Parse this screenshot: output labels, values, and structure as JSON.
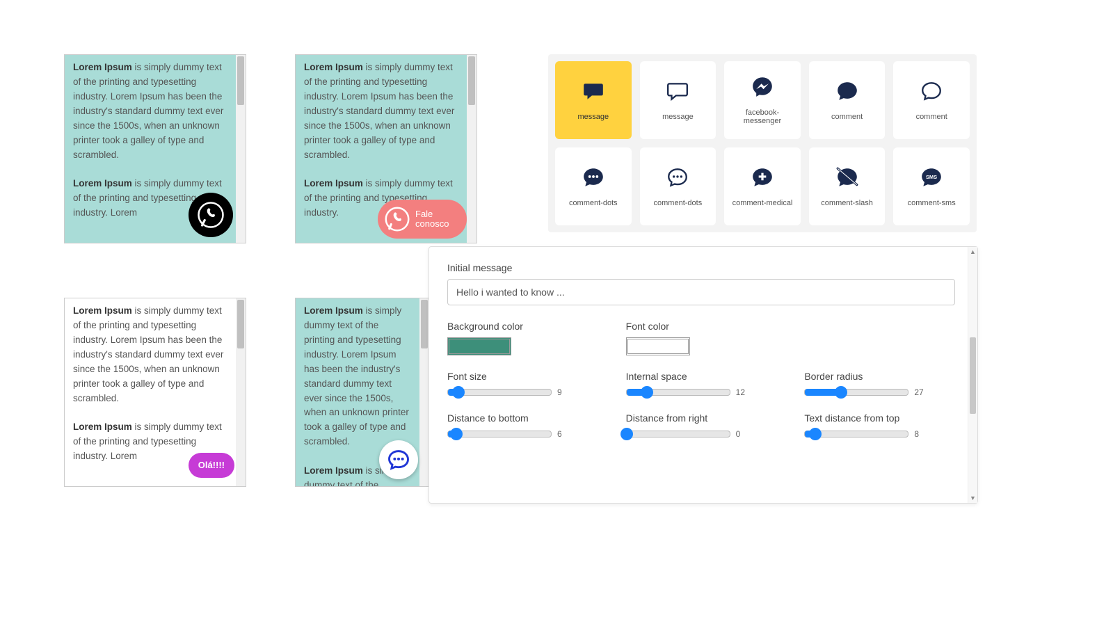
{
  "previews": [
    {
      "teal": true,
      "para1_bold": "Lorem Ipsum",
      "para1": " is simply dummy text of the printing and typesetting industry. Lorem Ipsum has been the industry's standard dummy text ever since the 1500s, when an unknown printer took a galley of type and scrambled.",
      "para2_bold": "Lorem Ipsum",
      "para2": " is simply dummy text of the printing and typesetting industry. Lorem"
    },
    {
      "teal": true,
      "para1_bold": "Lorem Ipsum",
      "para1": " is simply dummy text of the printing and typesetting industry. Lorem Ipsum has been the industry's standard dummy text ever since the 1500s, when an unknown printer took a galley of type and scrambled.",
      "para2_bold": "Lorem Ipsum",
      "para2": " is simply dummy text of the printing and typesetting industry."
    },
    {
      "teal": false,
      "para1_bold": "Lorem Ipsum",
      "para1": " is simply dummy text of the printing and typesetting industry. Lorem Ipsum has been the industry's standard dummy text ever since the 1500s, when an unknown printer took a galley of type and scrambled.",
      "para2_bold": "Lorem Ipsum",
      "para2": " is simply dummy text of the printing and typesetting industry. Lorem"
    },
    {
      "teal": true,
      "para1_bold": "Lorem Ipsum",
      "para1": " is simply dummy text of the printing and typesetting industry. Lorem Ipsum has been the industry's standard dummy text ever since the 1500s, when an unknown printer took a galley of type and scrambled.",
      "para2_bold": "Lorem Ipsum",
      "para2": " is simply dummy text of the printing and typesetting industry."
    }
  ],
  "badges": {
    "b1": {
      "bg": "#000000"
    },
    "b2": {
      "bg": "#f37f7f",
      "text": "Fale conosco"
    },
    "b3": {
      "bg": "#c63bd6",
      "text": "Olá!!!!"
    },
    "b4": {
      "bg": "#ffffff"
    }
  },
  "icons": [
    {
      "name": "message",
      "label": "message",
      "selected": true
    },
    {
      "name": "message-outline",
      "label": "message"
    },
    {
      "name": "facebook-messenger",
      "label": "facebook-messenger"
    },
    {
      "name": "comment-solid",
      "label": "comment"
    },
    {
      "name": "comment-outline",
      "label": "comment"
    },
    {
      "name": "comment-dots-solid",
      "label": "comment-dots"
    },
    {
      "name": "comment-dots-outline",
      "label": "comment-dots"
    },
    {
      "name": "comment-medical",
      "label": "comment-medical"
    },
    {
      "name": "comment-slash",
      "label": "comment-slash"
    },
    {
      "name": "comment-sms",
      "label": "comment-sms"
    }
  ],
  "settings": {
    "initial_message_label": "Initial message",
    "initial_message_value": "Hello i wanted to know ...",
    "bg_color_label": "Background color",
    "bg_color_value": "#3d8f7a",
    "font_color_label": "Font color",
    "font_color_value": "#ffffff",
    "sliders": [
      {
        "label": "Font size",
        "value": 9,
        "pct": 10
      },
      {
        "label": "Internal space",
        "value": 12,
        "pct": 20
      },
      {
        "label": "Border radius",
        "value": 27,
        "pct": 35
      },
      {
        "label": "Distance to bottom",
        "value": 6,
        "pct": 8
      },
      {
        "label": "Distance from right",
        "value": 0,
        "pct": 0
      },
      {
        "label": "Text distance from top",
        "value": 8,
        "pct": 10
      }
    ]
  }
}
